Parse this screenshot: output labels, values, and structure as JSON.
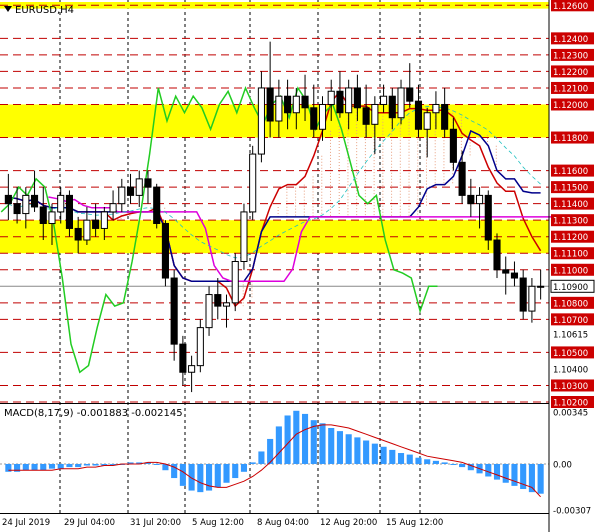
{
  "window": {
    "symbol_label": "EURUSD,H4",
    "menu_icon": "triangle-down-icon"
  },
  "chart_data": [
    {
      "type": "candlestick",
      "title": "EURUSD,H4",
      "ylim": [
        1.102,
        1.1262
      ],
      "current_price": 1.109,
      "price_ticks": [
        {
          "value": 1.126,
          "label": "1.12600",
          "boxed": true
        },
        {
          "value": 1.124,
          "label": "1.12400",
          "boxed": true
        },
        {
          "value": 1.123,
          "label": "1.12300",
          "boxed": true
        },
        {
          "value": 1.122,
          "label": "1.12200",
          "boxed": true
        },
        {
          "value": 1.121,
          "label": "1.12100",
          "boxed": true
        },
        {
          "value": 1.12,
          "label": "1.12000",
          "boxed": true
        },
        {
          "value": 1.118,
          "label": "1.11800",
          "boxed": true
        },
        {
          "value": 1.116,
          "label": "1.11600",
          "boxed": true
        },
        {
          "value": 1.115,
          "label": "1.11500",
          "boxed": true
        },
        {
          "value": 1.114,
          "label": "1.11400",
          "boxed": true
        },
        {
          "value": 1.113,
          "label": "1.11300",
          "boxed": true
        },
        {
          "value": 1.112,
          "label": "1.11200",
          "boxed": true
        },
        {
          "value": 1.111,
          "label": "1.11100",
          "boxed": true
        },
        {
          "value": 1.11,
          "label": "1.11000",
          "boxed": true
        },
        {
          "value": 1.109,
          "label": "1.10900",
          "boxed": false,
          "current": true
        },
        {
          "value": 1.108,
          "label": "1.10800",
          "boxed": true
        },
        {
          "value": 1.107,
          "label": "1.10700",
          "boxed": true
        },
        {
          "value": 1.1061,
          "label": "1.10615",
          "boxed": false
        },
        {
          "value": 1.105,
          "label": "1.10500",
          "boxed": true
        },
        {
          "value": 1.104,
          "label": "1.10400",
          "boxed": false
        },
        {
          "value": 1.103,
          "label": "1.10300",
          "boxed": true
        },
        {
          "value": 1.102,
          "label": "1.10200",
          "boxed": true
        }
      ],
      "horizontal_levels": [
        1.126,
        1.124,
        1.123,
        1.122,
        1.121,
        1.12,
        1.118,
        1.116,
        1.115,
        1.114,
        1.113,
        1.112,
        1.111,
        1.11,
        1.108,
        1.107,
        1.105,
        1.103,
        1.102
      ],
      "highlight_zones": [
        {
          "from": 1.1258,
          "to": 1.1262,
          "color": "#ffff00"
        },
        {
          "from": 1.118,
          "to": 1.12,
          "color": "#ffff00"
        },
        {
          "from": 1.111,
          "to": 1.113,
          "color": "#ffff00"
        }
      ],
      "candles": [
        [
          1.1145,
          1.1158,
          1.113,
          1.114
        ],
        [
          1.114,
          1.115,
          1.1128,
          1.1134
        ],
        [
          1.1134,
          1.115,
          1.1125,
          1.1145
        ],
        [
          1.1145,
          1.116,
          1.1135,
          1.1138
        ],
        [
          1.1138,
          1.115,
          1.1118,
          1.1128
        ],
        [
          1.1128,
          1.114,
          1.1115,
          1.1135
        ],
        [
          1.1135,
          1.115,
          1.1128,
          1.1145
        ],
        [
          1.1145,
          1.1148,
          1.112,
          1.1125
        ],
        [
          1.1125,
          1.1132,
          1.111,
          1.1118
        ],
        [
          1.1118,
          1.1138,
          1.1115,
          1.113
        ],
        [
          1.113,
          1.114,
          1.112,
          1.1125
        ],
        [
          1.1125,
          1.1138,
          1.1118,
          1.1135
        ],
        [
          1.1135,
          1.1148,
          1.113,
          1.114
        ],
        [
          1.114,
          1.1155,
          1.1135,
          1.115
        ],
        [
          1.115,
          1.1158,
          1.114,
          1.1145
        ],
        [
          1.1145,
          1.116,
          1.1138,
          1.1155
        ],
        [
          1.1155,
          1.116,
          1.114,
          1.115
        ],
        [
          1.115,
          1.1152,
          1.1125,
          1.1128
        ],
        [
          1.1128,
          1.113,
          1.109,
          1.1095
        ],
        [
          1.1095,
          1.11,
          1.1045,
          1.1055
        ],
        [
          1.1055,
          1.106,
          1.103,
          1.1038
        ],
        [
          1.1038,
          1.1048,
          1.1026,
          1.1042
        ],
        [
          1.1042,
          1.107,
          1.1038,
          1.1065
        ],
        [
          1.1065,
          1.109,
          1.106,
          1.1085
        ],
        [
          1.1085,
          1.1095,
          1.107,
          1.1078
        ],
        [
          1.1078,
          1.1085,
          1.1065,
          1.108
        ],
        [
          1.108,
          1.111,
          1.1075,
          1.1105
        ],
        [
          1.1105,
          1.114,
          1.11,
          1.1135
        ],
        [
          1.1135,
          1.1175,
          1.113,
          1.117
        ],
        [
          1.117,
          1.122,
          1.1165,
          1.121
        ],
        [
          1.121,
          1.1238,
          1.118,
          1.119
        ],
        [
          1.119,
          1.1215,
          1.118,
          1.1205
        ],
        [
          1.1205,
          1.1215,
          1.1185,
          1.1195
        ],
        [
          1.1195,
          1.121,
          1.1185,
          1.1205
        ],
        [
          1.1205,
          1.1218,
          1.119,
          1.1198
        ],
        [
          1.1198,
          1.1212,
          1.118,
          1.1185
        ],
        [
          1.1185,
          1.1205,
          1.1178,
          1.12
        ],
        [
          1.12,
          1.1215,
          1.119,
          1.1208
        ],
        [
          1.1208,
          1.122,
          1.1192,
          1.1195
        ],
        [
          1.1195,
          1.1215,
          1.1185,
          1.121
        ],
        [
          1.121,
          1.1218,
          1.119,
          1.1198
        ],
        [
          1.1198,
          1.1212,
          1.118,
          1.1188
        ],
        [
          1.1188,
          1.1205,
          1.117,
          1.12
        ],
        [
          1.12,
          1.1212,
          1.1195,
          1.1205
        ],
        [
          1.1205,
          1.121,
          1.1185,
          1.1192
        ],
        [
          1.1192,
          1.1215,
          1.1188,
          1.121
        ],
        [
          1.121,
          1.1225,
          1.1198,
          1.1202
        ],
        [
          1.1202,
          1.1212,
          1.118,
          1.1185
        ],
        [
          1.1185,
          1.1198,
          1.1168,
          1.1195
        ],
        [
          1.1195,
          1.1208,
          1.1185,
          1.12
        ],
        [
          1.12,
          1.121,
          1.118,
          1.1185
        ],
        [
          1.1185,
          1.1192,
          1.116,
          1.1165
        ],
        [
          1.1165,
          1.1172,
          1.114,
          1.1145
        ],
        [
          1.1145,
          1.1155,
          1.1132,
          1.114
        ],
        [
          1.114,
          1.115,
          1.1125,
          1.1145
        ],
        [
          1.1145,
          1.1148,
          1.1112,
          1.1118
        ],
        [
          1.1118,
          1.1122,
          1.1095,
          1.11
        ],
        [
          1.11,
          1.1108,
          1.1085,
          1.1098
        ],
        [
          1.1098,
          1.1105,
          1.109,
          1.1095
        ],
        [
          1.1095,
          1.11,
          1.107,
          1.1075
        ],
        [
          1.1075,
          1.1095,
          1.1068,
          1.109
        ],
        [
          1.109,
          1.11,
          1.1082,
          1.109
        ]
      ],
      "time_labels": [
        "24 Jul 2019",
        "29 Jul 04:00",
        "31 Jul 20:00",
        "5 Aug 12:00",
        "8 Aug 04:00",
        "12 Aug 20:00",
        "15 Aug 12:00"
      ]
    },
    {
      "type": "bar",
      "title": "MACD(8,17,9) -0.001883 -0.002145",
      "ylim": [
        -0.00307,
        0.00345
      ],
      "ticks": [
        {
          "value": 0.00345,
          "label": "0.00345"
        },
        {
          "value": 0.0,
          "label": "0.00"
        },
        {
          "value": -0.00307,
          "label": "-0.00307"
        }
      ],
      "series": [
        {
          "name": "MACD",
          "values": [
            -0.0005,
            -0.0005,
            -0.0004,
            -0.0004,
            -0.0004,
            -0.0003,
            -0.0003,
            -0.0002,
            -0.0002,
            -0.0001,
            -0.0001,
            -0.0001,
            0.0,
            0.0,
            0.0001,
            0.0001,
            0.0001,
            0.0,
            -0.0004,
            -0.0009,
            -0.0014,
            -0.0017,
            -0.0018,
            -0.0017,
            -0.0015,
            -0.0012,
            -0.0009,
            -0.0005,
            0.0001,
            0.0008,
            0.0016,
            0.0024,
            0.0031,
            0.0034,
            0.0032,
            0.0028,
            0.0026,
            0.0023,
            0.0021,
            0.0019,
            0.0017,
            0.0015,
            0.0013,
            0.0011,
            0.0009,
            0.0007,
            0.0006,
            0.0004,
            0.0003,
            0.0002,
            0.0001,
            0.0,
            -0.0002,
            -0.0004,
            -0.0006,
            -0.0008,
            -0.001,
            -0.0012,
            -0.0014,
            -0.0016,
            -0.0018,
            -0.0019
          ]
        },
        {
          "name": "Signal",
          "values": [
            -0.0004,
            -0.0004,
            -0.0004,
            -0.0004,
            -0.0004,
            -0.0004,
            -0.0003,
            -0.0003,
            -0.0003,
            -0.0002,
            -0.0002,
            -0.0001,
            -0.0001,
            0.0,
            0.0,
            0.0,
            0.0001,
            0.0001,
            0.0,
            -0.0002,
            -0.0005,
            -0.0009,
            -0.0012,
            -0.0014,
            -0.0015,
            -0.0015,
            -0.0013,
            -0.0011,
            -0.0008,
            -0.0004,
            0.0001,
            0.0007,
            0.0013,
            0.0019,
            0.0022,
            0.0024,
            0.0025,
            0.0025,
            0.0024,
            0.0023,
            0.0021,
            0.0019,
            0.0017,
            0.0015,
            0.0013,
            0.0011,
            0.0009,
            0.0007,
            0.0005,
            0.0004,
            0.0003,
            0.0002,
            0.0001,
            -0.0001,
            -0.0003,
            -0.0005,
            -0.0007,
            -0.0009,
            -0.0011,
            -0.0013,
            -0.0015,
            -0.0021
          ]
        }
      ]
    }
  ]
}
